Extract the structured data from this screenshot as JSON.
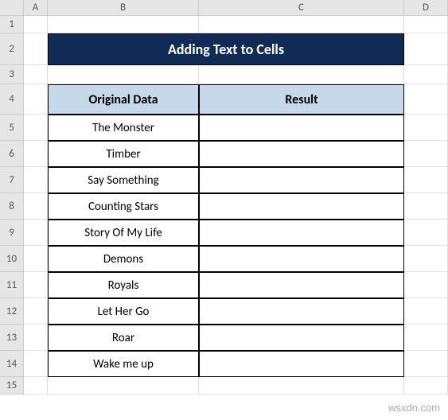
{
  "columns": [
    "A",
    "B",
    "C",
    "D"
  ],
  "title": "Adding Text to Cells",
  "headers": {
    "original": "Original Data",
    "result": "Result"
  },
  "rows": [
    {
      "n": 1
    },
    {
      "n": 2
    },
    {
      "n": 3
    },
    {
      "n": 4
    },
    {
      "n": 5,
      "original": "The Monster",
      "result": ""
    },
    {
      "n": 6,
      "original": "Timber",
      "result": ""
    },
    {
      "n": 7,
      "original": "Say Something",
      "result": ""
    },
    {
      "n": 8,
      "original": "Counting Stars",
      "result": ""
    },
    {
      "n": 9,
      "original": "Story Of My Life",
      "result": ""
    },
    {
      "n": 10,
      "original": "Demons",
      "result": ""
    },
    {
      "n": 11,
      "original": "Royals",
      "result": ""
    },
    {
      "n": 12,
      "original": "Let Her Go",
      "result": ""
    },
    {
      "n": 13,
      "original": "Roar",
      "result": ""
    },
    {
      "n": 14,
      "original": "Wake me up",
      "result": ""
    },
    {
      "n": 15
    }
  ],
  "watermark": "wsxdn.com"
}
